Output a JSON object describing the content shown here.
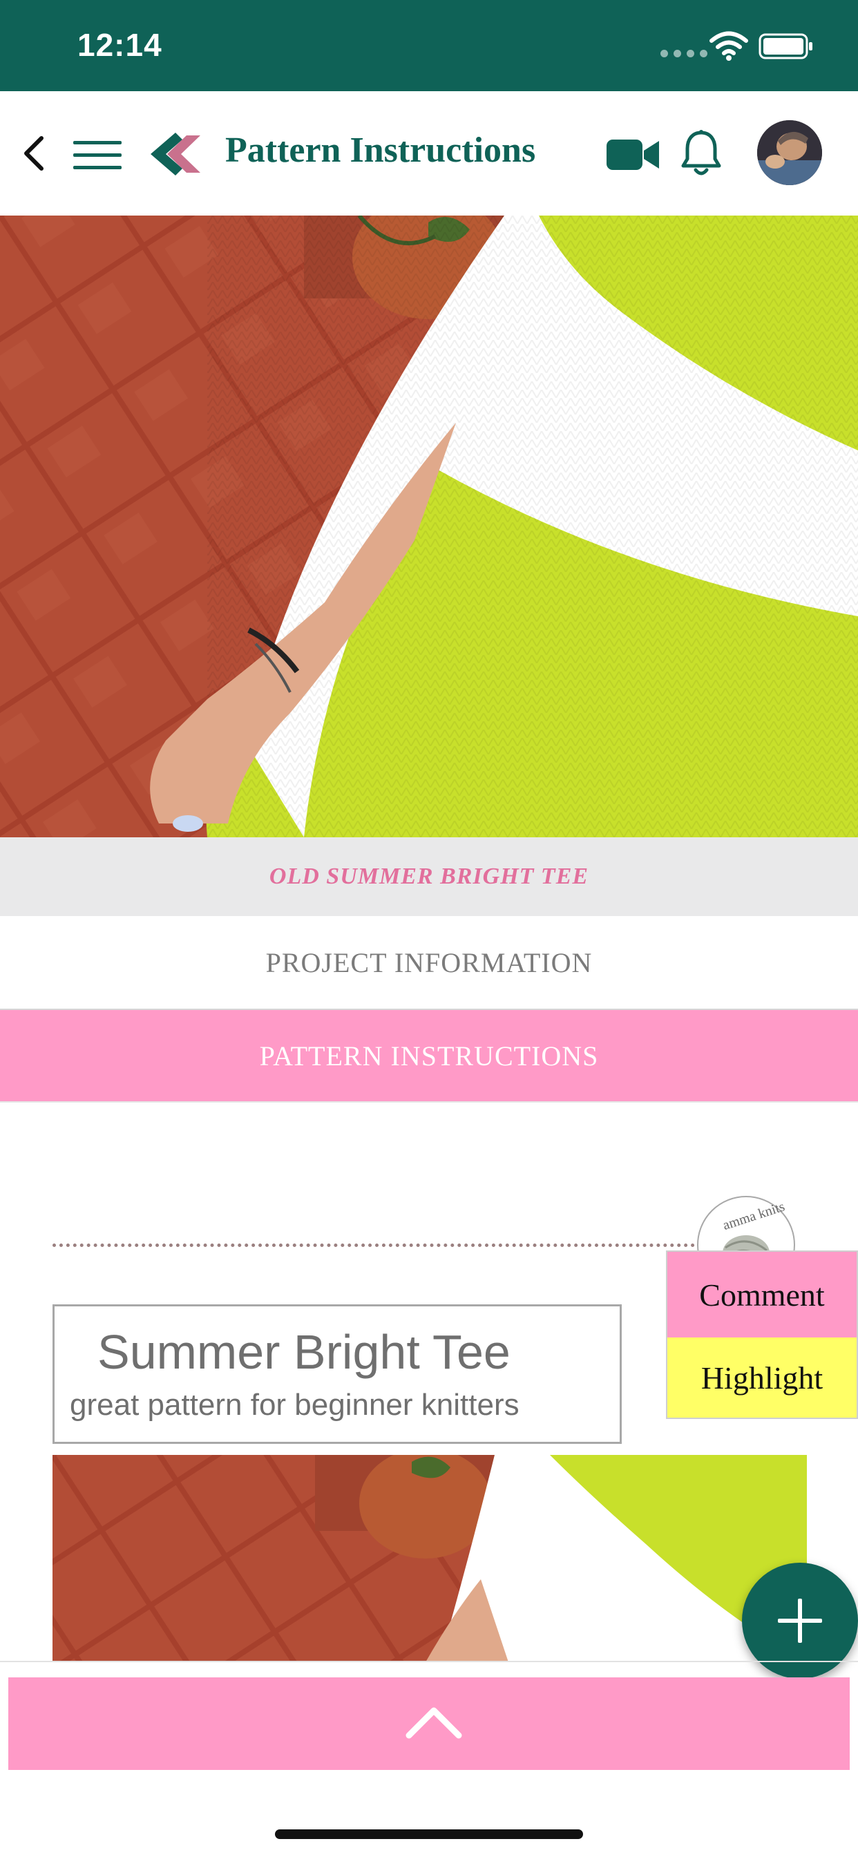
{
  "status_bar": {
    "time": "12:14"
  },
  "header": {
    "title": "Pattern Instructions"
  },
  "project": {
    "name": "OLD SUMMER BRIGHT TEE"
  },
  "tabs": [
    {
      "label": "PROJECT INFORMATION",
      "active": false
    },
    {
      "label": "PATTERN INSTRUCTIONS",
      "active": true
    }
  ],
  "document": {
    "title": "Summer Bright Tee",
    "subtitle": "great pattern for beginner knitters",
    "brand_seal_text": "amma knits"
  },
  "context_menu": {
    "comment_label": "Comment",
    "highlight_label": "Highlight"
  },
  "icons": {
    "back": "back-chevron-icon",
    "menu": "hamburger-menu-icon",
    "logo": "brand-logo-icon",
    "video": "video-camera-icon",
    "notifications": "bell-icon",
    "add": "plus-icon",
    "scroll_top": "chevron-up-icon"
  },
  "colors": {
    "brand_green": "#0f6257",
    "accent_pink": "#ff9ac7",
    "title_pink": "#e26f9c",
    "highlight_yellow": "#ffff66"
  }
}
